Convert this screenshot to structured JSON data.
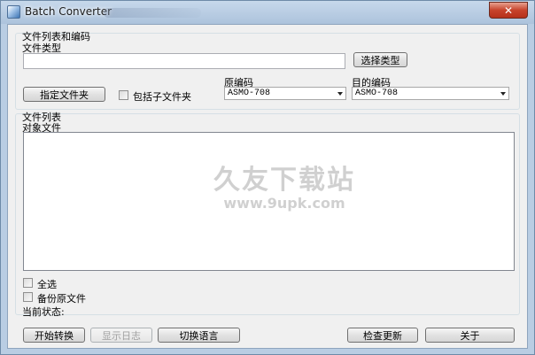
{
  "window": {
    "title": "Batch Converter",
    "close_glyph": "✕"
  },
  "files_group": {
    "title": "文件列表和编码",
    "file_type_label": "文件类型",
    "file_type_value": "",
    "select_type_button": "选择类型",
    "specify_folder_button": "指定文件夹",
    "include_subfolders_label": "包括子文件夹",
    "include_subfolders_checked": false,
    "source_encoding_label": "原编码",
    "source_encoding_value": "ASMO-708",
    "target_encoding_label": "目的编码",
    "target_encoding_value": "ASMO-708"
  },
  "list_group": {
    "title": "文件列表",
    "objects_label": "对象文件",
    "watermark_main": "久友下载站",
    "watermark_sub": "www.9upk.com",
    "select_all_label": "全选",
    "select_all_checked": false,
    "backup_label": "备份原文件",
    "backup_checked": false,
    "status_label": "当前状态:"
  },
  "buttons": {
    "start": "开始转换",
    "show_log": "显示日志",
    "switch_language": "切换语言",
    "check_update": "检查更新",
    "about": "关于"
  }
}
